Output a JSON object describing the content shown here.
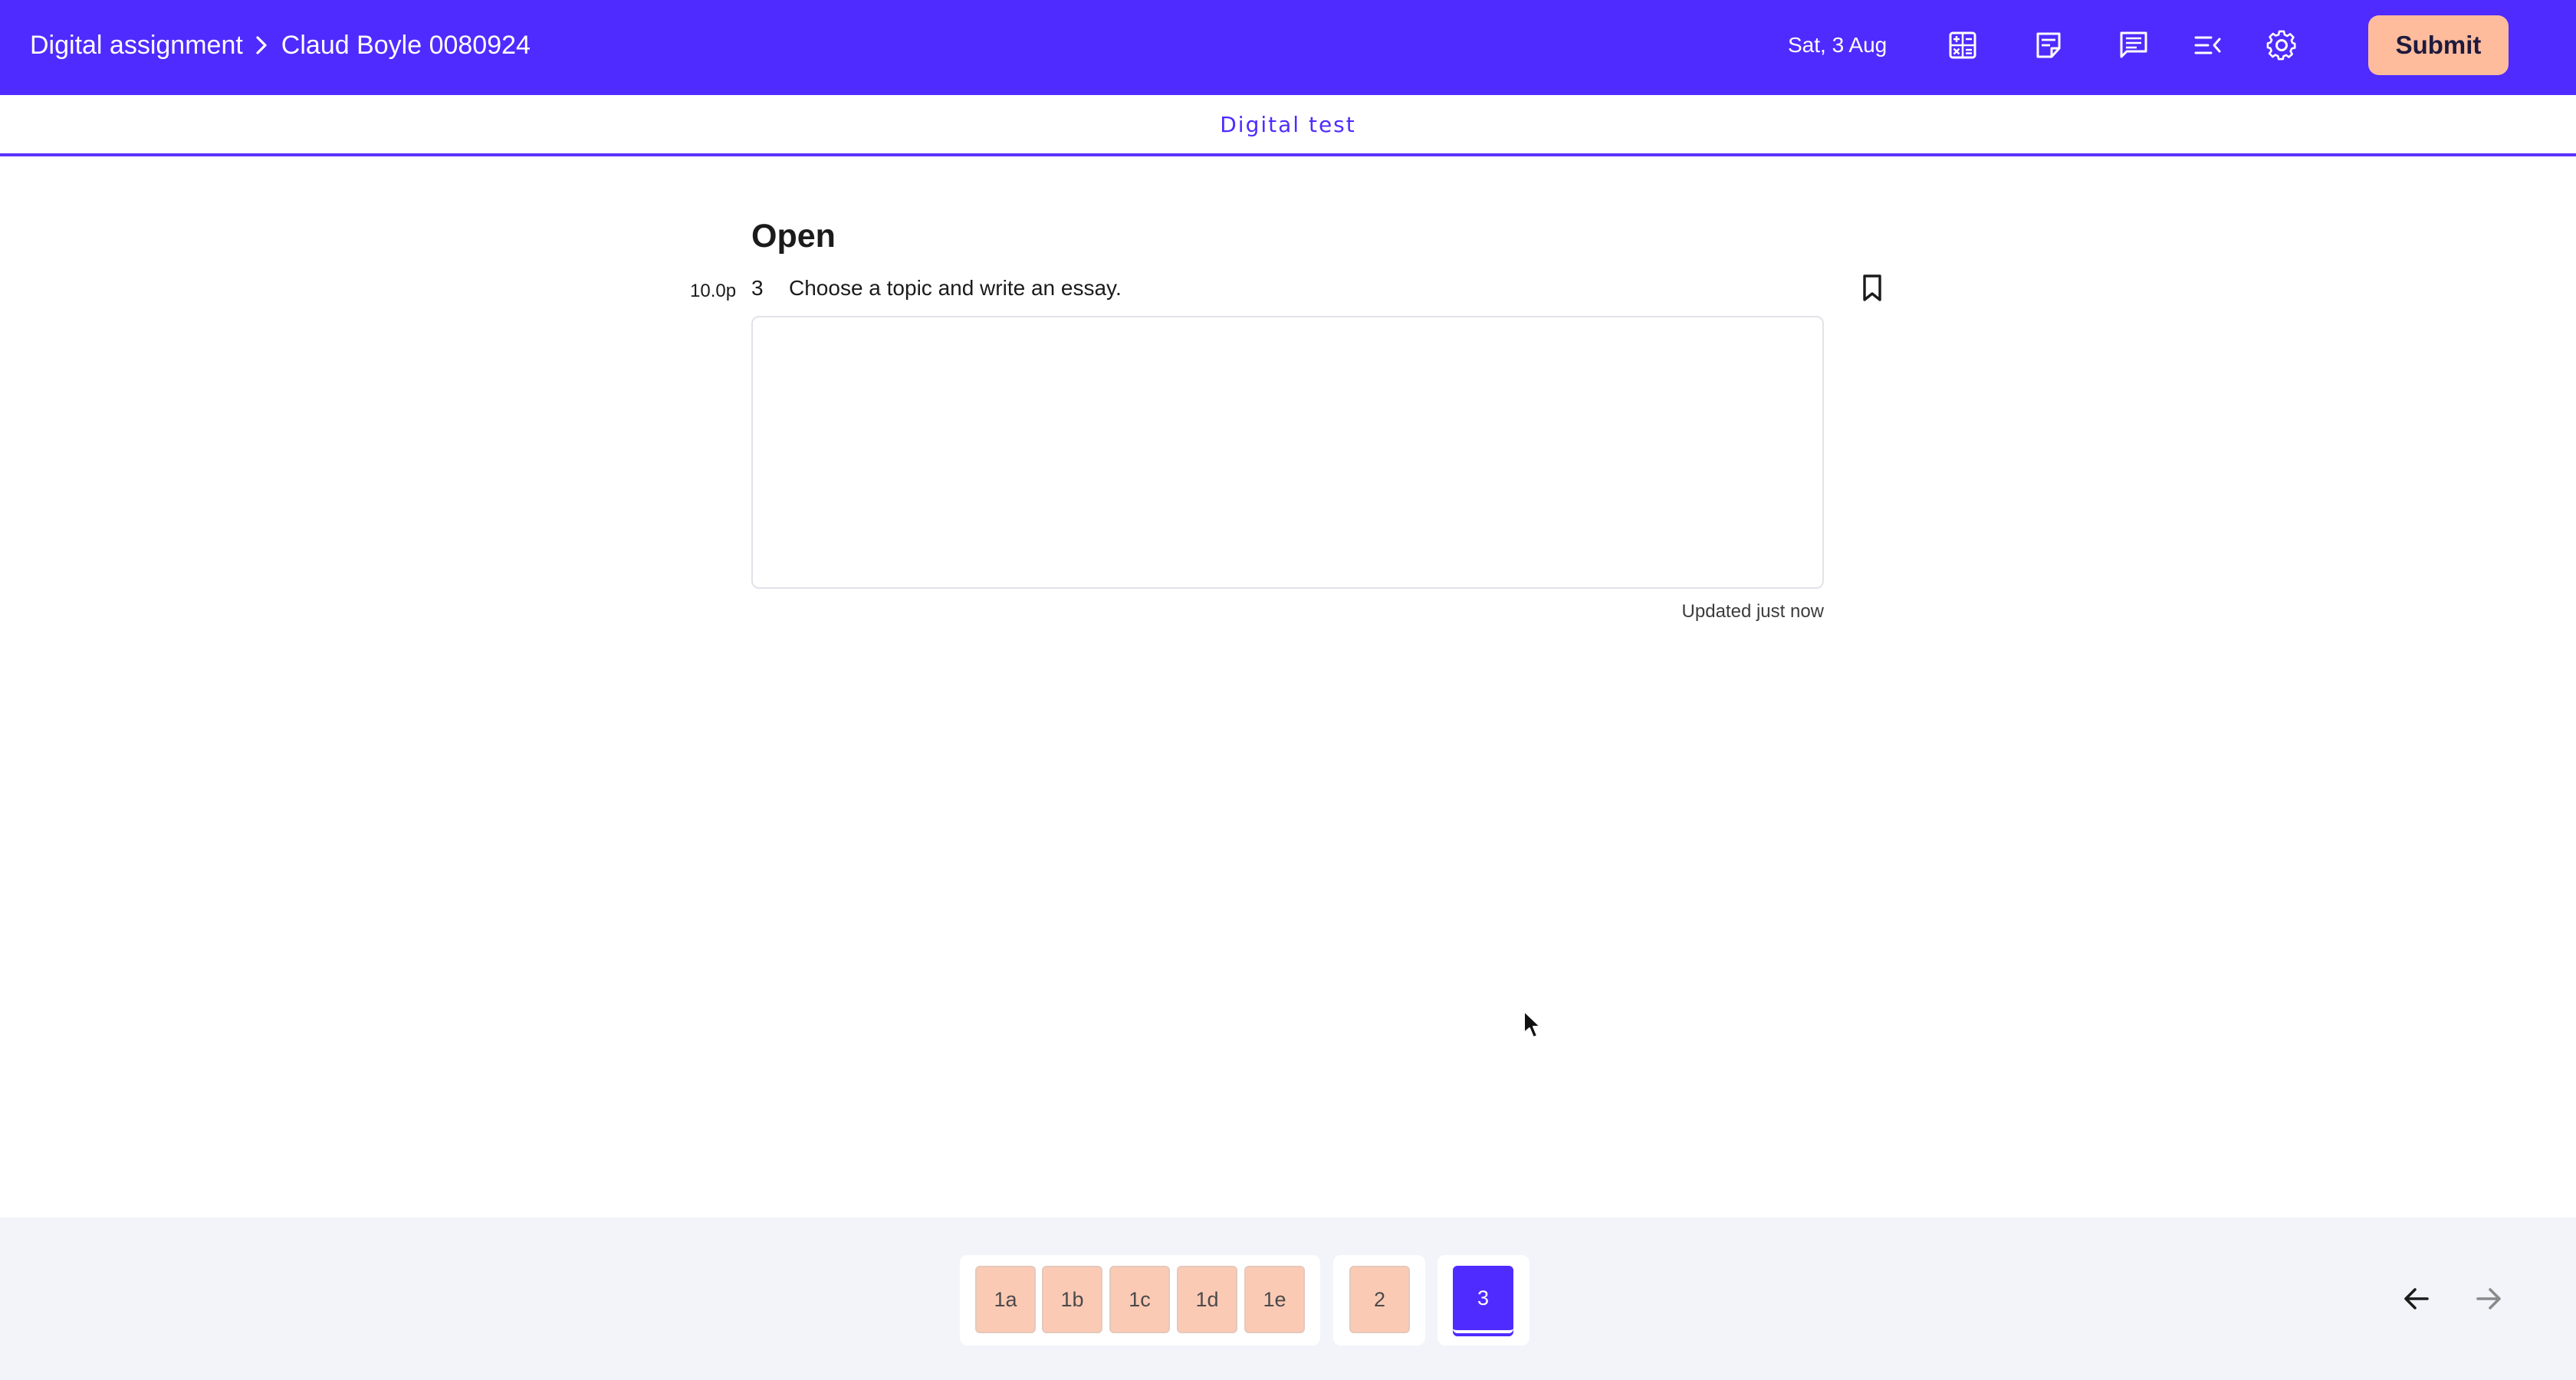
{
  "header": {
    "breadcrumb": [
      "Digital assignment",
      "Claud Boyle 0080924"
    ],
    "date": "Sat, 3 Aug",
    "tools": [
      "calculator-icon",
      "notes-icon",
      "chat-icon",
      "collapse-menu-icon",
      "gear-icon"
    ],
    "submit_label": "Submit"
  },
  "section": {
    "title": "Digital test"
  },
  "question": {
    "heading": "Open",
    "points": "10.0p",
    "number": "3",
    "text": "Choose a topic and write an essay.",
    "answer_value": "",
    "status": "Updated just now"
  },
  "navigation": {
    "groups": [
      [
        "1a",
        "1b",
        "1c",
        "1d",
        "1e"
      ],
      [
        "2"
      ],
      [
        "3"
      ]
    ],
    "current": "3"
  },
  "colors": {
    "brand": "#4f2bff",
    "submit": "#ffbc9c",
    "answered": "#fbcab5",
    "footer": "#f3f4fa"
  }
}
